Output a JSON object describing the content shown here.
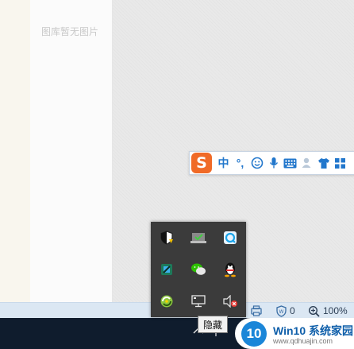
{
  "gallery": {
    "empty_text": "图库暂无图片"
  },
  "ime": {
    "logo": "S",
    "items": [
      {
        "name": "chinese-mode",
        "glyph": "中"
      },
      {
        "name": "punctuation",
        "glyph": "°,"
      },
      {
        "name": "emoji-icon",
        "glyph": "☺"
      },
      {
        "name": "microphone-icon",
        "glyph": "🎤"
      },
      {
        "name": "keyboard-icon",
        "glyph": "⌨"
      },
      {
        "name": "user-icon",
        "glyph": "👤"
      },
      {
        "name": "skin-icon",
        "glyph": "👕"
      },
      {
        "name": "toolbox-icon",
        "glyph": "▦"
      }
    ]
  },
  "statusbar": {
    "zoom": "100%",
    "partial_value": "0"
  },
  "tray": {
    "icons": [
      "security-shield-icon",
      "network-check-icon",
      "browser-sync-icon",
      "app-cube-icon",
      "wechat-icon",
      "qq-penguin-icon",
      "cloud-sync-icon",
      "display-icon",
      "volume-muted-icon"
    ]
  },
  "tooltip": {
    "text": "隐藏"
  },
  "watermark": {
    "logo": "10",
    "title": "Win10 系统家园",
    "url": "www.qdhuajin.com"
  },
  "colors": {
    "taskbar": "#0f1c2d",
    "tray_bg": "#3b3b3b",
    "statusbar": "#dbe7f3",
    "ime_accent": "#2277cc",
    "sogou_orange": "#f06a27"
  }
}
